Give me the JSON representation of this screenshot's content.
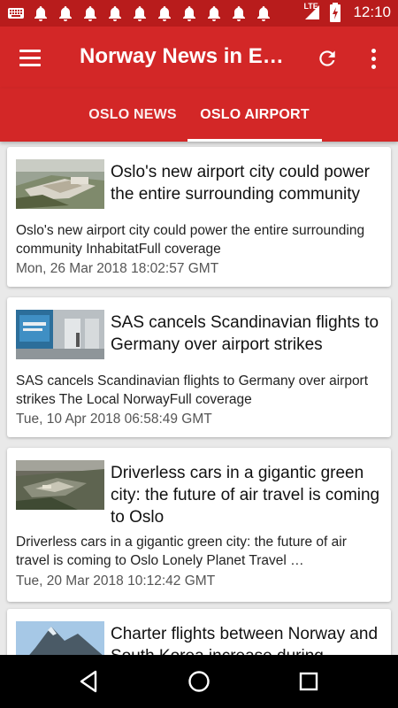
{
  "status_bar": {
    "time": "12:10",
    "network": "LTE",
    "left_icons": [
      "keyboard-icon",
      "notification-bell-icon",
      "notification-bell-icon",
      "notification-bell-icon",
      "notification-bell-icon",
      "notification-bell-icon",
      "notification-bell-icon",
      "notification-bell-icon",
      "notification-bell-icon",
      "notification-bell-icon",
      "notification-bell-icon"
    ]
  },
  "app_bar": {
    "title": "Norway News in En…",
    "color": "#d32727",
    "status_color": "#b81c1c"
  },
  "tabs": [
    {
      "label": "OSLO NEWS",
      "selected": false
    },
    {
      "label": "OSLO AIRPORT",
      "selected": true
    }
  ],
  "articles": [
    {
      "title": "Oslo's new airport city could power the entire surrounding community",
      "description": "Oslo's new airport city could power the entire surrounding community  InhabitatFull coverage",
      "date": "Mon, 26 Mar 2018 18:02:57 GMT"
    },
    {
      "title": "SAS cancels Scandinavian flights to Germany over airport strikes",
      "description": "SAS cancels Scandinavian flights to Germany over airport strikes  The Local NorwayFull coverage",
      "date": "Tue, 10 Apr 2018 06:58:49 GMT"
    },
    {
      "title": "Driverless cars in a gigantic green city: the future of air travel is coming to Oslo",
      "description": "Driverless cars in a gigantic green city: the future of air travel is coming to Oslo  Lonely Planet Travel …",
      "date": "Tue, 20 Mar 2018 10:12:42 GMT"
    },
    {
      "title": "Charter flights between Norway and South Korea increase during"
    }
  ]
}
